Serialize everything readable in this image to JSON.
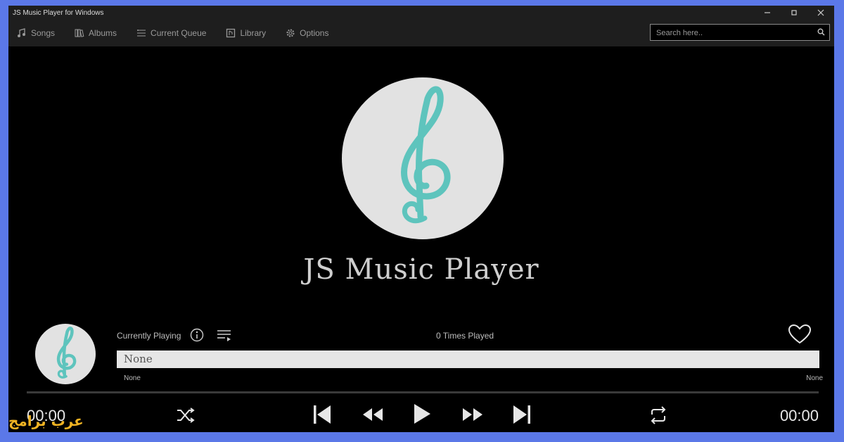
{
  "window": {
    "title": "JS Music Player for Windows"
  },
  "nav": {
    "items": [
      {
        "label": "Songs",
        "icon": "music-note-icon"
      },
      {
        "label": "Albums",
        "icon": "album-icon"
      },
      {
        "label": "Current Queue",
        "icon": "queue-icon"
      },
      {
        "label": "Library",
        "icon": "library-icon"
      },
      {
        "label": "Options",
        "icon": "gear-icon"
      }
    ],
    "search_placeholder": "Search here.."
  },
  "main": {
    "app_name": "JS Music Player"
  },
  "now_playing": {
    "label": "Currently Playing",
    "times_played": "0 Times Played",
    "title": "None",
    "artist": "None",
    "album": "None",
    "elapsed": "00:00",
    "duration": "00:00"
  },
  "watermark": "عرب برامج",
  "colors": {
    "accent": "#5ec4bd",
    "background": "#000000",
    "frame": "#5b78e8"
  }
}
